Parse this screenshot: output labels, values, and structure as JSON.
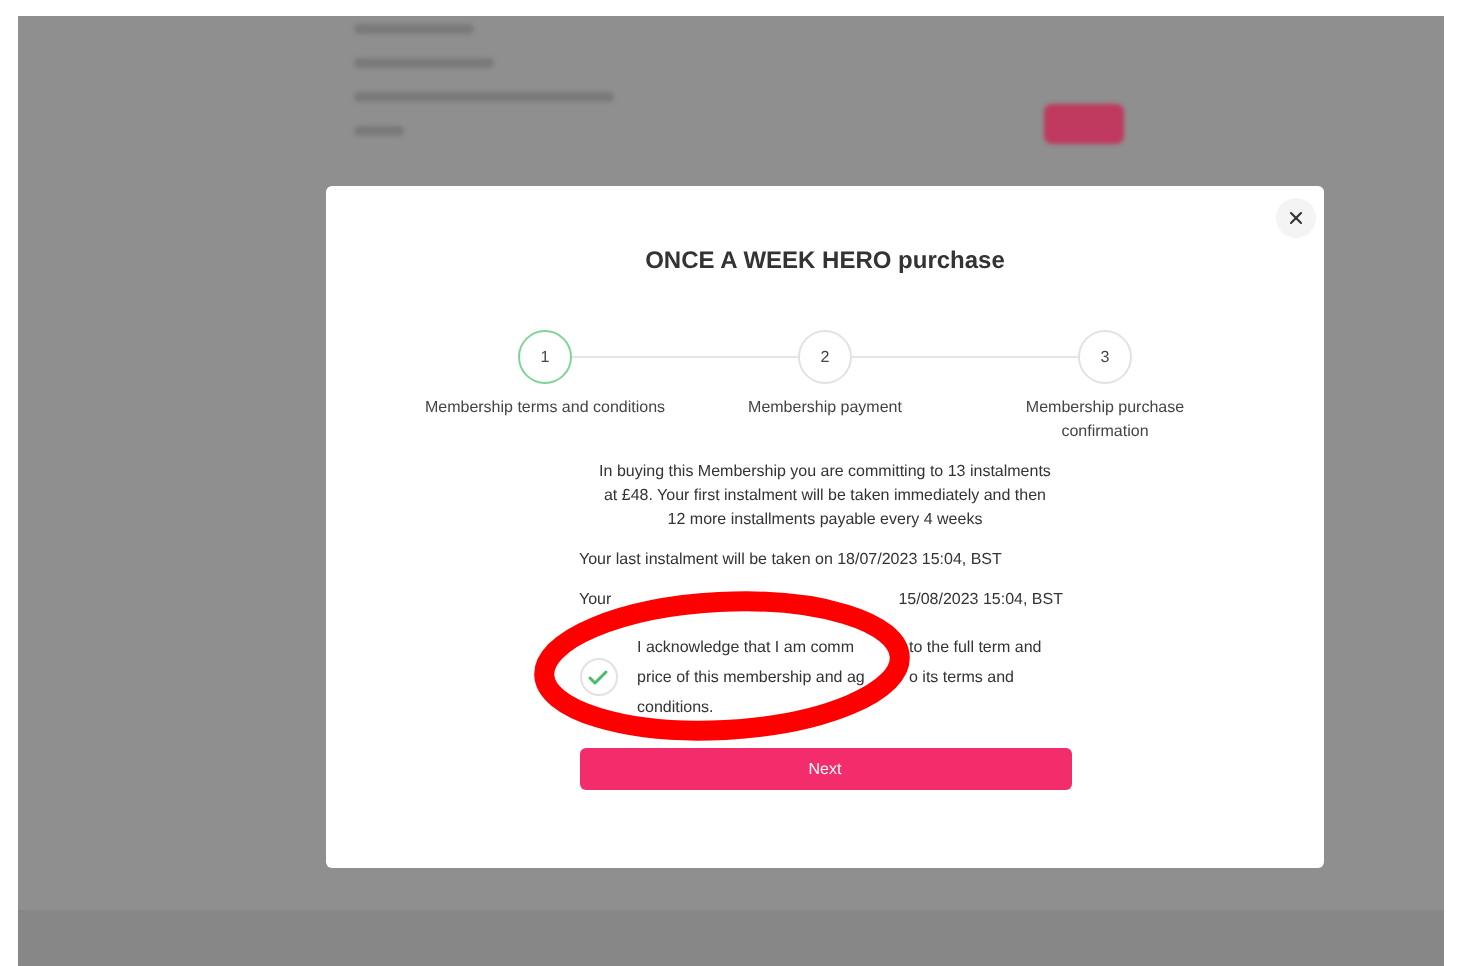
{
  "dialog": {
    "title": "ONCE A WEEK HERO purchase",
    "steps": [
      {
        "number": "1",
        "label": "Membership terms and conditions",
        "selected": true
      },
      {
        "number": "2",
        "label": "Membership payment",
        "selected": false
      },
      {
        "number": "3",
        "label": "Membership purchase confirmation",
        "selected": false
      }
    ],
    "intro": "In buying this Membership you are committing to 13 instalments at £48. Your first instalment will be taken immediately and then 12 more installments payable every 4 weeks",
    "last_instalment": "Your last instalment will be taken on 18/07/2023 15:04, BST",
    "next_line": {
      "before": "Your",
      "after": "15/08/2023 15:04, BST"
    },
    "acknowledgement": {
      "checked": true,
      "lines": [
        {
          "before": "I acknowledge that I am comm",
          "after": "to the full term and"
        },
        {
          "before": "price of this membership and ag",
          "after": "o its terms and"
        },
        {
          "before": "conditions."
        }
      ]
    },
    "button": "Next"
  }
}
